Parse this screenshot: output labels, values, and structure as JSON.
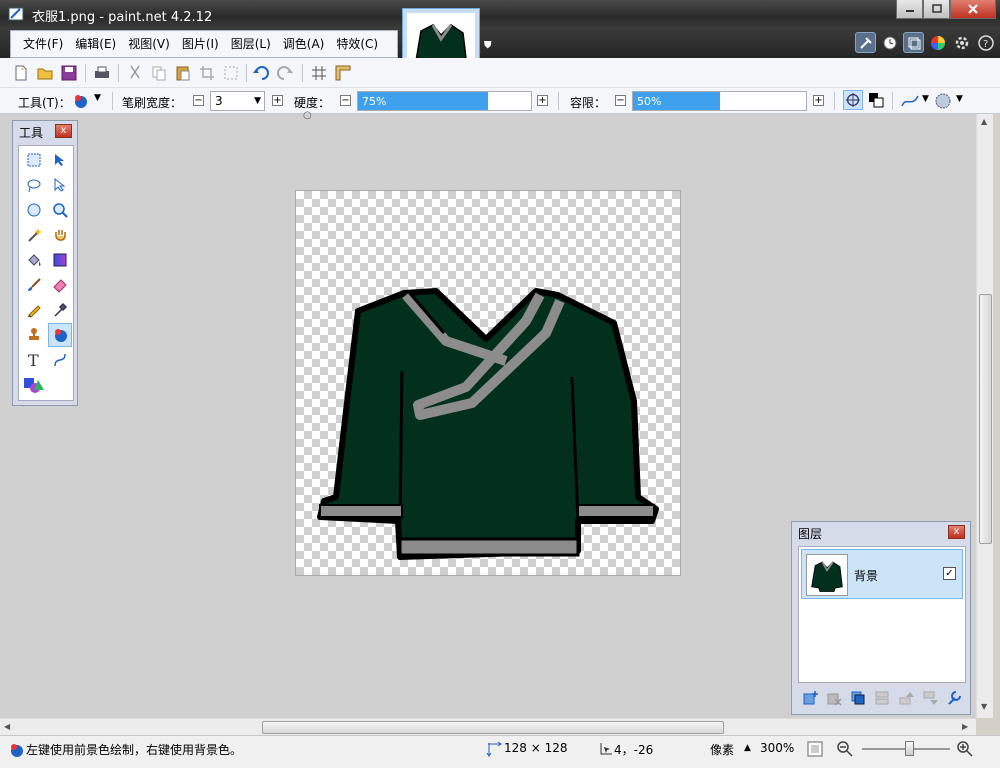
{
  "window": {
    "title": "衣服1.png - paint.net 4.2.12"
  },
  "menu": [
    "文件(F)",
    "编辑(E)",
    "视图(V)",
    "图片(I)",
    "图层(L)",
    "调色(A)",
    "特效(C)"
  ],
  "toolbar2": {
    "tool_label": "工具(T)：",
    "brush_width_label": "笔刷宽度：",
    "brush_width_value": "3",
    "hardness_label": "硬度：",
    "hardness_value": "75%",
    "hardness_fraction": 0.75,
    "tolerance_label": "容限：",
    "tolerance_value": "50%",
    "tolerance_fraction": 0.5
  },
  "tools_panel": {
    "title": "工具",
    "close": "x"
  },
  "layers_panel": {
    "title": "图层",
    "close": "x",
    "layer_name": "背景",
    "layer_visible_mark": "✓"
  },
  "status": {
    "hint": "左键使用前景色绘制，右键使用背景色。",
    "image_size": "128 × 128",
    "cursor_pos": "4，-26",
    "units": "像素",
    "zoom": "300%"
  },
  "colors": {
    "shirt": "#03301d",
    "trim": "#8c8c8c",
    "outline": "#000000",
    "accent": "#3fa1ee"
  }
}
